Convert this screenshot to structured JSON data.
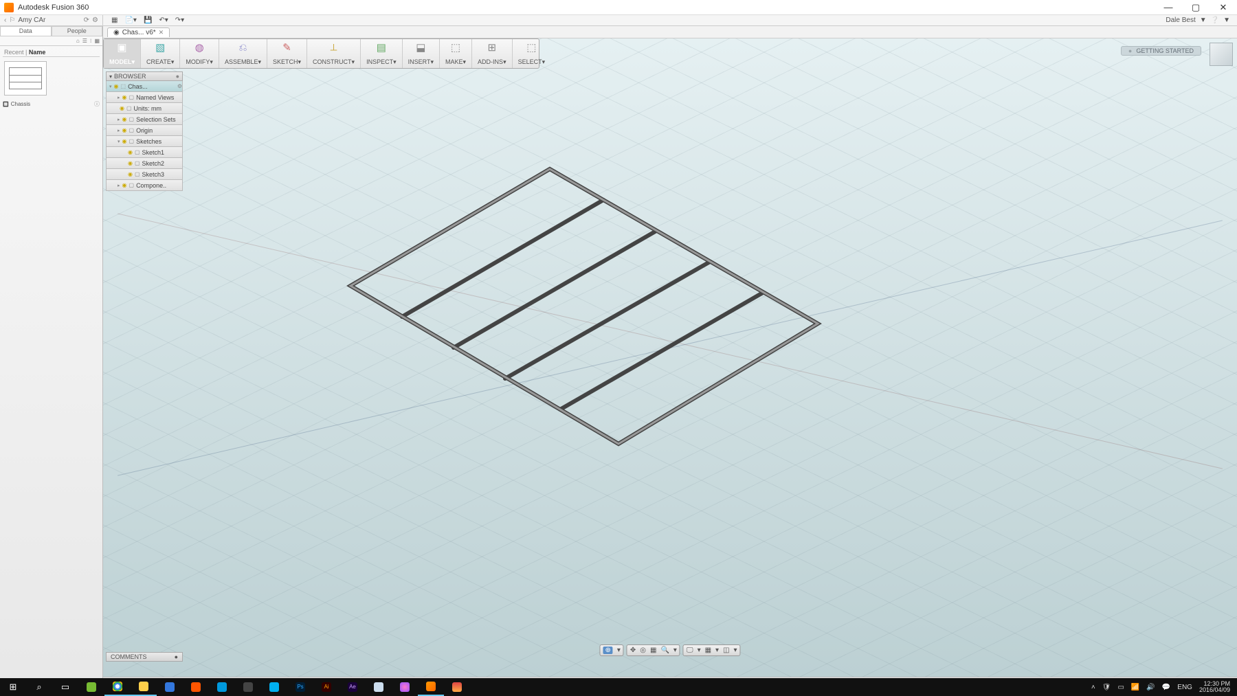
{
  "app_title": "Autodesk Fusion 360",
  "user_name": "Dale Best",
  "project_name": "Amy CAr",
  "data_tabs": [
    "Data",
    "People"
  ],
  "search_label": "Recent",
  "search_sort": "Name",
  "thumbnail_name": "Chassis",
  "doc_tab": "Chas... v6*",
  "ribbon": {
    "model": "MODEL",
    "items": [
      "CREATE",
      "MODIFY",
      "ASSEMBLE",
      "SKETCH",
      "CONSTRUCT",
      "INSPECT",
      "INSERT",
      "MAKE",
      "ADD-INS",
      "SELECT"
    ]
  },
  "browser_title": "BROWSER",
  "tree": {
    "root": "Chas...",
    "items": [
      {
        "label": "Named Views",
        "lv": 1,
        "tri": "▸"
      },
      {
        "label": "Units: mm",
        "lv": 1,
        "tri": ""
      },
      {
        "label": "Selection Sets",
        "lv": 1,
        "tri": "▸"
      },
      {
        "label": "Origin",
        "lv": 1,
        "tri": "▸"
      },
      {
        "label": "Sketches",
        "lv": 1,
        "tri": "▾"
      },
      {
        "label": "Sketch1",
        "lv": 2,
        "tri": ""
      },
      {
        "label": "Sketch2",
        "lv": 2,
        "tri": ""
      },
      {
        "label": "Sketch3",
        "lv": 2,
        "tri": ""
      },
      {
        "label": "Compone..",
        "lv": 1,
        "tri": "▸"
      }
    ]
  },
  "comments_label": "COMMENTS",
  "getting_started": "GETTING STARTED",
  "clock": {
    "time": "12:30 PM",
    "date": "2016/04/09"
  },
  "lang": "ENG"
}
